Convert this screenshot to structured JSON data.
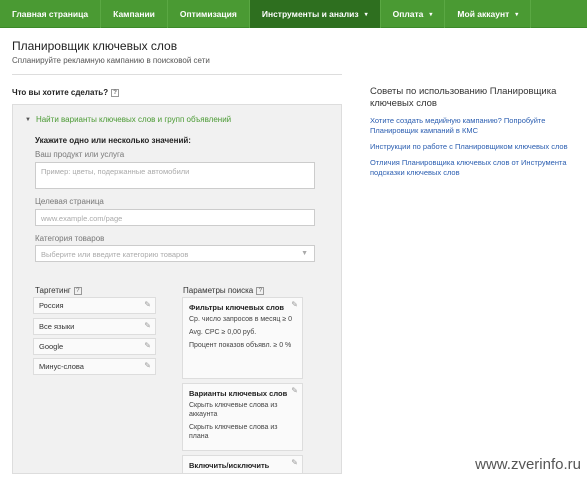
{
  "nav": {
    "items": [
      {
        "label": "Главная страница",
        "active": false,
        "dropdown": false
      },
      {
        "label": "Кампании",
        "active": false,
        "dropdown": false
      },
      {
        "label": "Оптимизация",
        "active": false,
        "dropdown": false
      },
      {
        "label": "Инструменты и анализ",
        "active": true,
        "dropdown": true
      },
      {
        "label": "Оплата",
        "active": false,
        "dropdown": true
      },
      {
        "label": "Мой аккаунт",
        "active": false,
        "dropdown": true
      }
    ],
    "caret": "▾"
  },
  "header": {
    "title": "Планировщик ключевых слов",
    "subtitle": "Спланируйте рекламную кампанию в поисковой сети"
  },
  "question": {
    "label": "Что вы хотите сделать?",
    "help": "?"
  },
  "panel": {
    "heading": "Найти варианты ключевых слов и групп объявлений",
    "instruction": "Укажите одно или несколько значений:",
    "product_label": "Ваш продукт или услуга",
    "product_placeholder": "Пример: цветы, подержанные автомобили",
    "landing_label": "Целевая страница",
    "landing_placeholder": "www.example.com/page",
    "category_label": "Категория товаров",
    "category_placeholder": "Выберите или введите категорию товаров",
    "targeting_label": "Таргетинг",
    "targeting_items": [
      "Россия",
      "Все языки",
      "Google",
      "Минус-слова"
    ],
    "search_params_label": "Параметры поиска",
    "filter_title": "Фильтры ключевых слов",
    "filter_rows": [
      "Ср. число запросов в месяц ≥ 0",
      "Avg. CPC ≥ 0,00 руб.",
      "Процент показов объявл. ≥ 0 %"
    ],
    "variants_title": "Варианты ключевых слов",
    "variants_rows": [
      "Скрыть ключевые слова из аккаунта",
      "Скрыть ключевые слова из плана"
    ],
    "include_title": "Включить/исключить"
  },
  "tips": {
    "title": "Советы по использованию Планировщика ключевых слов",
    "links": [
      "Хотите создать медийную кампанию? Попробуйте Планировщик кампаний в КМС",
      "Инструкции по работе с Планировщиком ключевых слов",
      "Отличия Планировщика ключевых слов от Инструмента подсказки ключевых слов"
    ]
  },
  "watermark": "www.zverinfo.ru",
  "colors": {
    "nav": "#4a9a33",
    "nav_active": "#2e6f1f",
    "link": "#2a5db0",
    "accent": "#4a9a33"
  }
}
